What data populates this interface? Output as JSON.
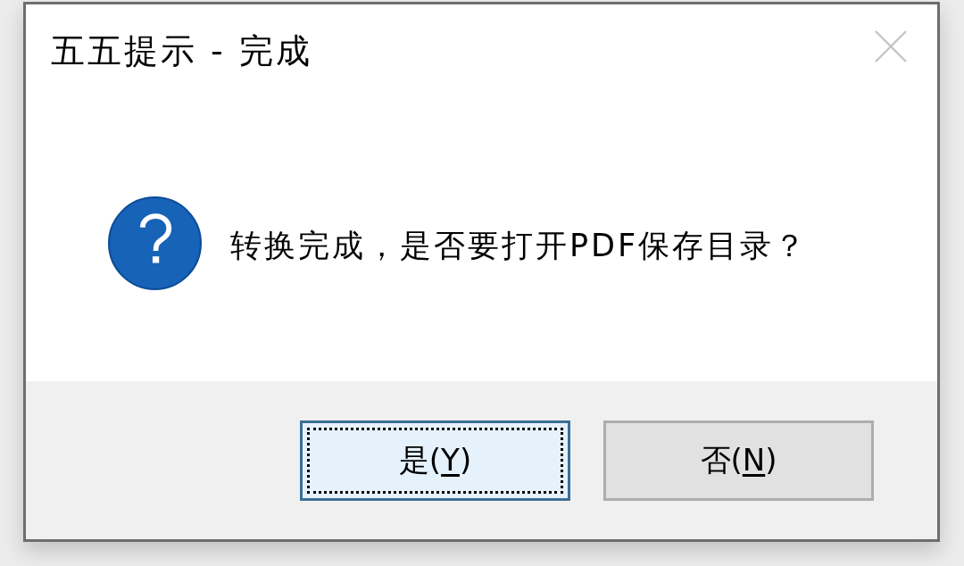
{
  "window": {
    "title": "五五提示 - 完成",
    "close_button": {
      "disabled": true
    }
  },
  "message": {
    "text": "转换完成，是否要打开PDF保存目录？"
  },
  "buttons": [
    {
      "prefix": "是(",
      "access_key": "Y",
      "suffix": ")",
      "focused": true
    },
    {
      "prefix": "否(",
      "access_key": "N",
      "suffix": ")",
      "focused": false
    }
  ]
}
